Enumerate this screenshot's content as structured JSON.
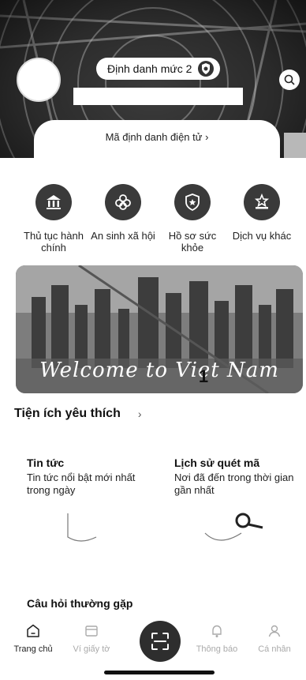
{
  "header": {
    "level_label": "Định danh mức 2",
    "id_tab_label": "Mã định danh điện tử",
    "id_tab_chevron": "›"
  },
  "quick_actions": [
    {
      "label": "Thủ tục hành chính",
      "icon": "government-building-icon"
    },
    {
      "label": "An sinh xã hội",
      "icon": "social-welfare-icon"
    },
    {
      "label": "Hồ sơ sức khỏe",
      "icon": "health-record-icon"
    },
    {
      "label": "Dịch vụ khác",
      "icon": "other-services-icon"
    }
  ],
  "banner": {
    "text": "Welcome to Viet Nam",
    "number": "1"
  },
  "favorites": {
    "title": "Tiện ích yêu thích",
    "chevron": "›",
    "cards": [
      {
        "title": "Tin tức",
        "desc": "Tin tức nổi bật mới nhất trong ngày"
      },
      {
        "title": "Lịch sử quét mã",
        "desc": "Nơi đã đến trong thời gian gần nhất"
      }
    ],
    "faq_title": "Câu hỏi thường gặp"
  },
  "nav": [
    {
      "label": "Trang chủ",
      "icon": "home-icon"
    },
    {
      "label": "Ví giấy tờ",
      "icon": "wallet-icon"
    },
    {
      "label": "Thông báo",
      "icon": "bell-icon"
    },
    {
      "label": "Cá nhân",
      "icon": "person-icon"
    }
  ],
  "colors": {
    "accent": "#2e2e2e",
    "header_bg": "#2b2b2b"
  }
}
